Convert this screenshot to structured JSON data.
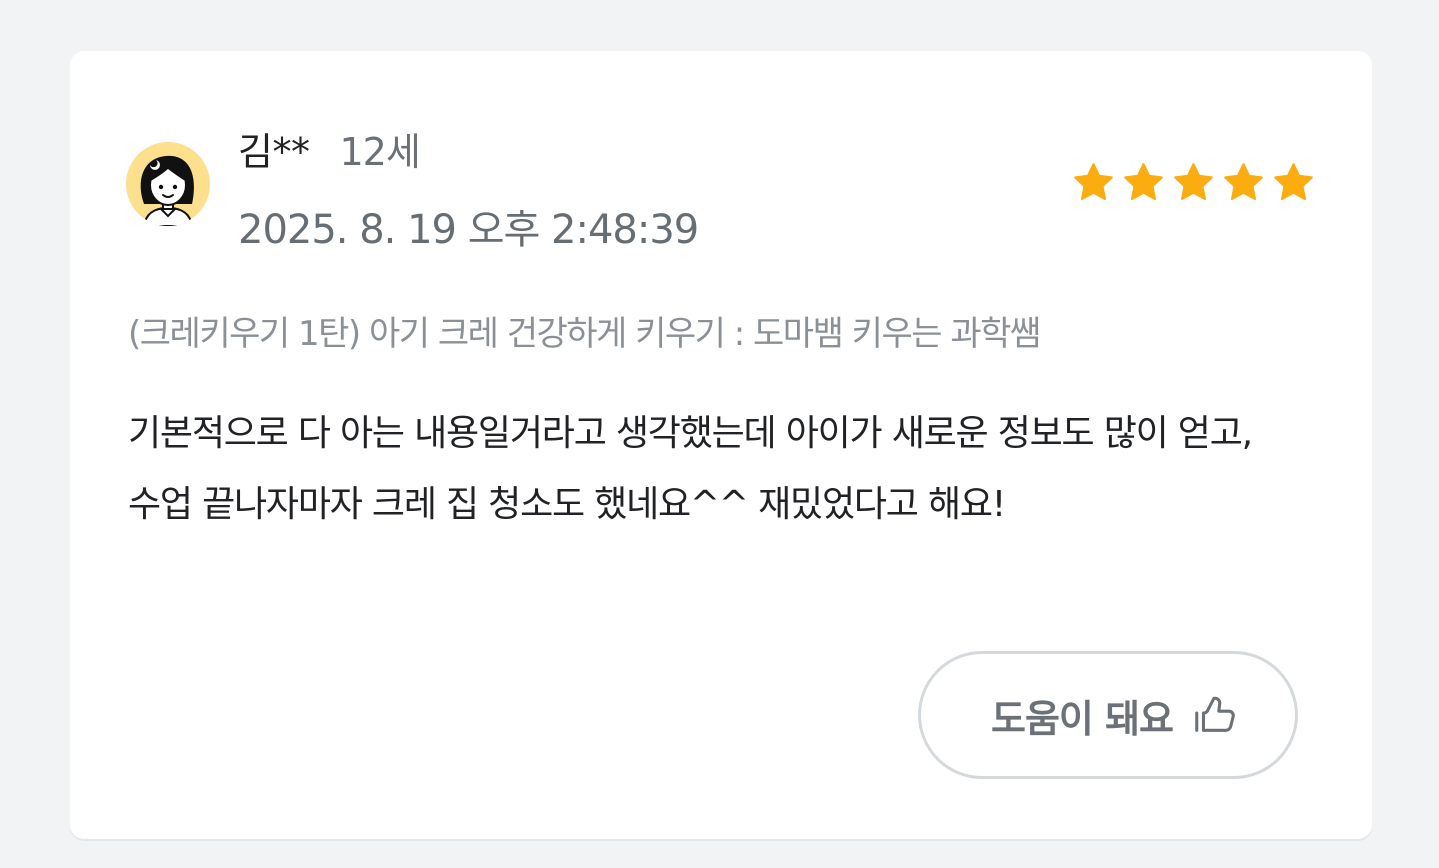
{
  "review": {
    "author_name": "김**",
    "author_age": "12세",
    "date": "2025. 8. 19 오후 2:48:39",
    "rating": 5,
    "max_rating": 5,
    "course_title": "(크레키우기 1탄) 아기 크레 건강하게 키우기 : 도마뱀 키우는 과학쌤",
    "body": "기본적으로 다 아는 내용일거라고 생각했는데 아이가 새로운 정보도 많이 얻고, 수업 끝나자마자 크레 집 청소도 했네요^^ 재밌었다고 해요!"
  },
  "helpful_button": {
    "label": "도움이 돼요",
    "icon": "thumbs-up-icon"
  },
  "colors": {
    "star": "#fbad0f",
    "avatar_background": "#fce08e",
    "page_background": "#f1f3f5"
  },
  "avatar": {
    "icon": "girl-avatar-icon"
  }
}
